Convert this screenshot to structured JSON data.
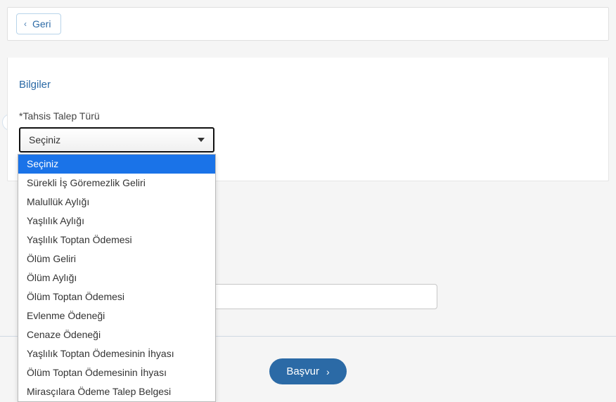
{
  "topbar": {
    "back_label": "Geri"
  },
  "section": {
    "title": "Bilgiler"
  },
  "field": {
    "label": "*Tahsis Talep Türü",
    "selected": "Seçiniz",
    "options": [
      "Seçiniz",
      "Sürekli İş Göremezlik Geliri",
      "Malullük Aylığı",
      "Yaşlılık Aylığı",
      "Yaşlılık Toptan Ödemesi",
      "Ölüm Geliri",
      "Ölüm Aylığı",
      "Ölüm Toptan Ödemesi",
      "Evlenme Ödeneği",
      "Cenaze Ödeneği",
      "Yaşlılık Toptan Ödemesinin İhyası",
      "Ölüm Toptan Ödemesinin İhyası",
      "Mirasçılara Ödeme Talep Belgesi"
    ]
  },
  "text_input": {
    "value": ""
  },
  "submit": {
    "label": "Başvur"
  }
}
